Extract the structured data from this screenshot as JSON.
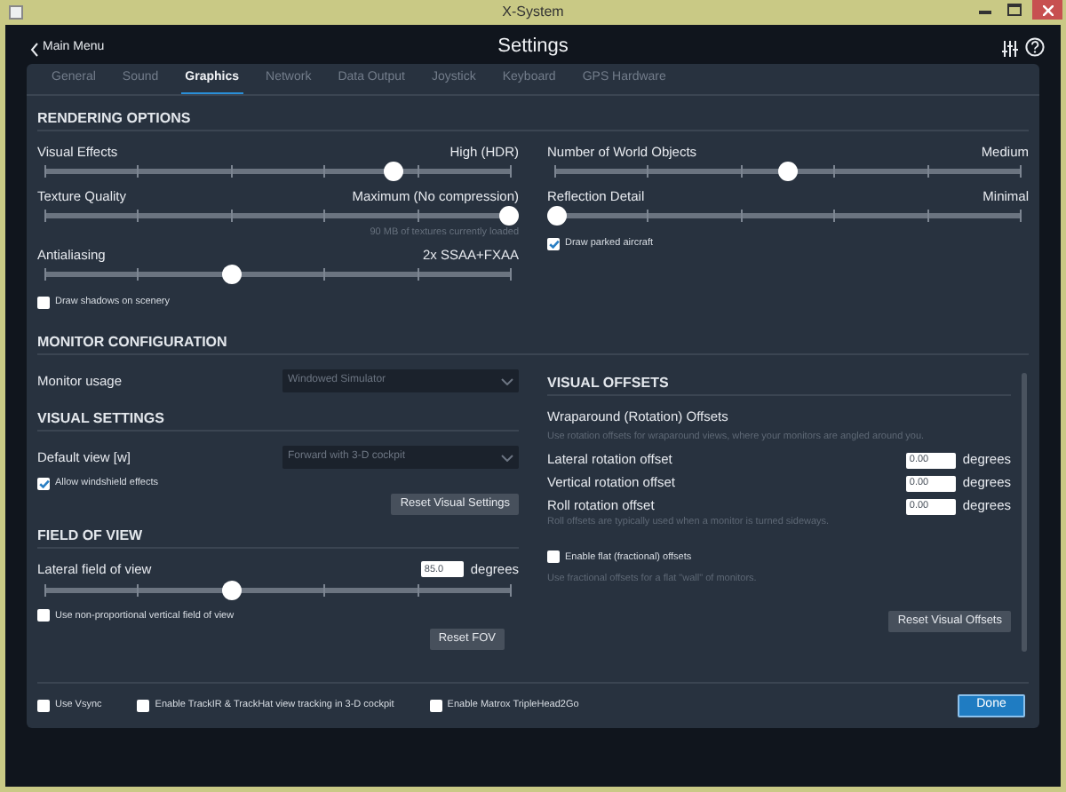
{
  "window": {
    "title": "X-System"
  },
  "header": {
    "back": "Main Menu",
    "title": "Settings"
  },
  "tabs": [
    {
      "label": "General",
      "selected": false
    },
    {
      "label": "Sound",
      "selected": false
    },
    {
      "label": "Graphics",
      "selected": true
    },
    {
      "label": "Network",
      "selected": false
    },
    {
      "label": "Data Output",
      "selected": false
    },
    {
      "label": "Joystick",
      "selected": false
    },
    {
      "label": "Keyboard",
      "selected": false
    },
    {
      "label": "GPS Hardware",
      "selected": false
    }
  ],
  "rendering": {
    "heading": "RENDERING OPTIONS",
    "left": [
      {
        "kind": "slider",
        "label": "Visual Effects",
        "value": "High (HDR)",
        "level": 0.75
      },
      {
        "kind": "slider",
        "label": "Texture Quality",
        "value": "Maximum (No compression)",
        "level": 1,
        "note": "90 MB of textures currently loaded"
      },
      {
        "kind": "slider",
        "label": "Antialiasing",
        "value": "2x SSAA+FXAA",
        "level": 0.4
      },
      {
        "kind": "checkbox",
        "label": "Draw shadows on scenery",
        "checked": false
      }
    ],
    "right": [
      {
        "kind": "slider",
        "label": "Number of World Objects",
        "value": "Medium",
        "level": 0.5
      },
      {
        "kind": "slider",
        "label": "Reflection Detail",
        "value": "Minimal",
        "level": 0
      },
      {
        "kind": "checkbox",
        "label": "Draw parked aircraft",
        "checked": true
      }
    ]
  },
  "monitor": {
    "heading": "MONITOR CONFIGURATION",
    "label": "Monitor usage",
    "value": "Windowed Simulator"
  },
  "visual_settings": {
    "heading": "VISUAL SETTINGS",
    "label": "Default view [w]",
    "value": "Forward with 3-D cockpit",
    "windshield": {
      "label": "Allow windshield effects",
      "checked": true
    },
    "reset": "Reset Visual Settings"
  },
  "field_of_view": {
    "heading": "FIELD OF VIEW",
    "label": "Lateral field of view",
    "value": "85.0",
    "unit": "degrees",
    "level": 0.4,
    "nonproportional": {
      "label": "Use non-proportional vertical field of view",
      "checked": false
    },
    "reset": "Reset FOV"
  },
  "visual_offsets": {
    "heading": "VISUAL OFFSETS",
    "subheading": "Wraparound (Rotation) Offsets",
    "description": "Use rotation offsets for wraparound views, where your monitors are angled around you.",
    "offsets": [
      {
        "label": "Lateral rotation offset",
        "value": "0.00",
        "unit": "degrees"
      },
      {
        "label": "Vertical rotation offset",
        "value": "0.00",
        "unit": "degrees"
      },
      {
        "label": "Roll rotation offset",
        "value": "0.00",
        "unit": "degrees"
      }
    ],
    "roll_note": "Roll offsets are typically used when a monitor is turned sideways.",
    "flat": {
      "label": "Enable flat (fractional) offsets",
      "checked": false
    },
    "flat_description": "Use fractional offsets for a flat \"wall\" of monitors.",
    "reset": "Reset Visual Offsets"
  },
  "footer": {
    "options": [
      {
        "label": "Use Vsync",
        "checked": false
      },
      {
        "label": "Enable TrackIR & TrackHat view tracking in 3-D cockpit",
        "checked": false
      },
      {
        "label": "Enable Matrox TripleHead2Go",
        "checked": false
      }
    ],
    "done": "Done"
  }
}
